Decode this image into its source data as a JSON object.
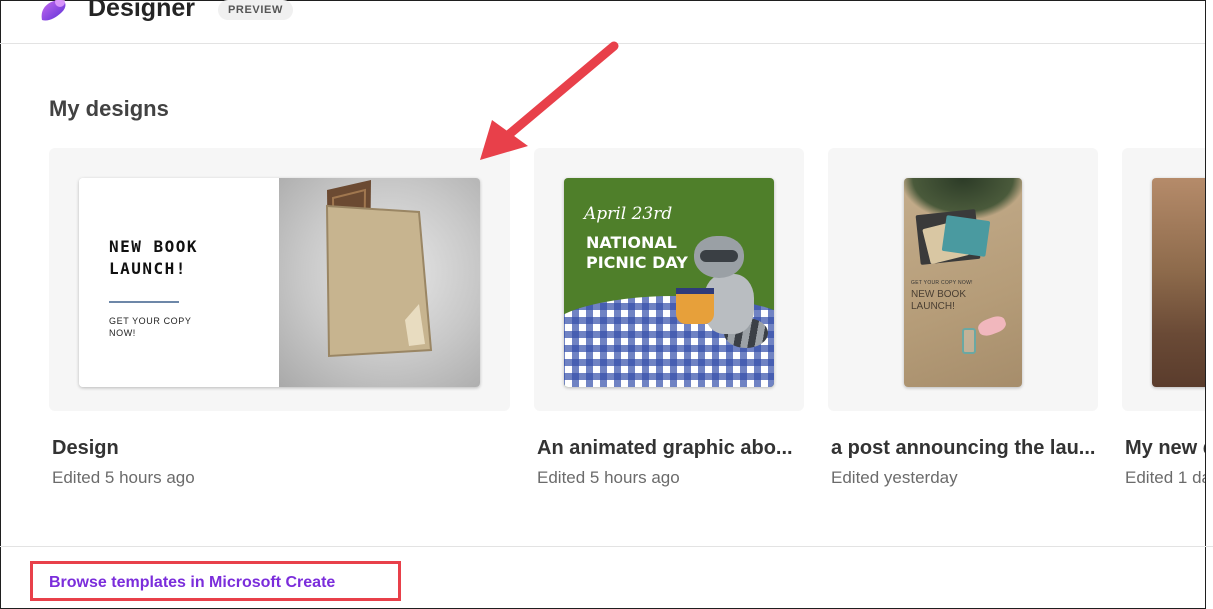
{
  "header": {
    "app_title": "Designer",
    "badge": "PREVIEW"
  },
  "section": {
    "title": "My designs"
  },
  "designs": [
    {
      "name": "Design",
      "edited": "Edited 5 hours ago",
      "thumbnail": {
        "title": "NEW BOOK\nLAUNCH!",
        "cta": "GET YOUR COPY\nNOW!"
      }
    },
    {
      "name": "An animated graphic abo...",
      "edited": "Edited 5 hours ago",
      "thumbnail": {
        "date": "April 23rd",
        "title": "NATIONAL\nPICNIC DAY"
      }
    },
    {
      "name": "a post announcing the lau...",
      "edited": "Edited yesterday",
      "thumbnail": {
        "small": "GET YOUR COPY NOW!",
        "title": "NEW BOOK\nLAUNCH!"
      }
    },
    {
      "name": "My new d",
      "edited": "Edited 1 da"
    }
  ],
  "footer": {
    "browse_link": "Browse templates in Microsoft Create"
  },
  "annotation_colors": {
    "arrow": "#e8404a",
    "highlight_box": "#e8404a",
    "link": "#7b2ddb"
  }
}
